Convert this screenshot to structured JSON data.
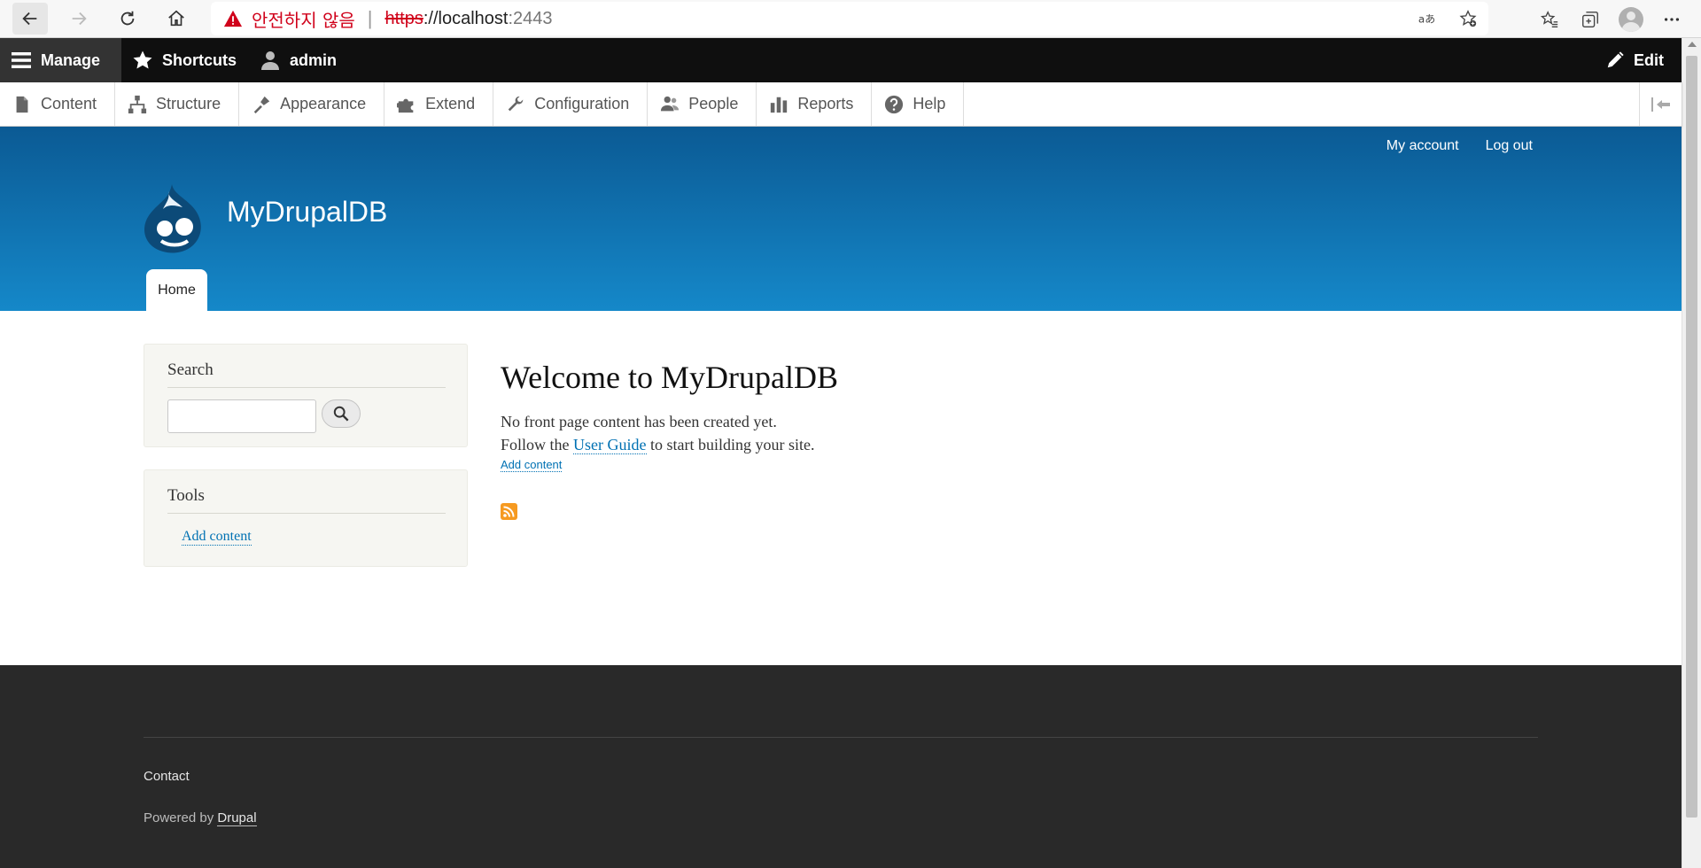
{
  "browser": {
    "insecure_label": "안전하지 않음",
    "url_scheme": "https",
    "url_host": "://localhost",
    "url_port": ":2443"
  },
  "toolbar": {
    "manage": "Manage",
    "shortcuts": "Shortcuts",
    "user": "admin",
    "edit": "Edit"
  },
  "tray": {
    "items": [
      {
        "label": "Content",
        "icon": "file-icon"
      },
      {
        "label": "Structure",
        "icon": "sitemap-icon"
      },
      {
        "label": "Appearance",
        "icon": "paintbrush-icon"
      },
      {
        "label": "Extend",
        "icon": "puzzle-icon"
      },
      {
        "label": "Configuration",
        "icon": "wrench-icon"
      },
      {
        "label": "People",
        "icon": "people-icon"
      },
      {
        "label": "Reports",
        "icon": "bar-chart-icon"
      },
      {
        "label": "Help",
        "icon": "question-icon"
      }
    ]
  },
  "header": {
    "my_account": "My account",
    "log_out": "Log out",
    "site_name": "MyDrupalDB",
    "home_tab": "Home"
  },
  "sidebar": {
    "search_title": "Search",
    "tools_title": "Tools",
    "tools_link": "Add content"
  },
  "main": {
    "title": "Welcome to MyDrupalDB",
    "line1": "No front page content has been created yet.",
    "line2_before": "Follow the ",
    "line2_link": "User Guide",
    "line2_after": " to start building your site.",
    "add_content": "Add content"
  },
  "footer": {
    "contact": "Contact",
    "powered_by": "Powered by ",
    "drupal": "Drupal"
  },
  "colors": {
    "header_top": "#0b5a94",
    "header_bottom": "#1588c9",
    "link": "#0071b3",
    "footer_bg": "#292929",
    "toolbar_bg": "#0f0f0f",
    "feed": "#f69a21"
  }
}
